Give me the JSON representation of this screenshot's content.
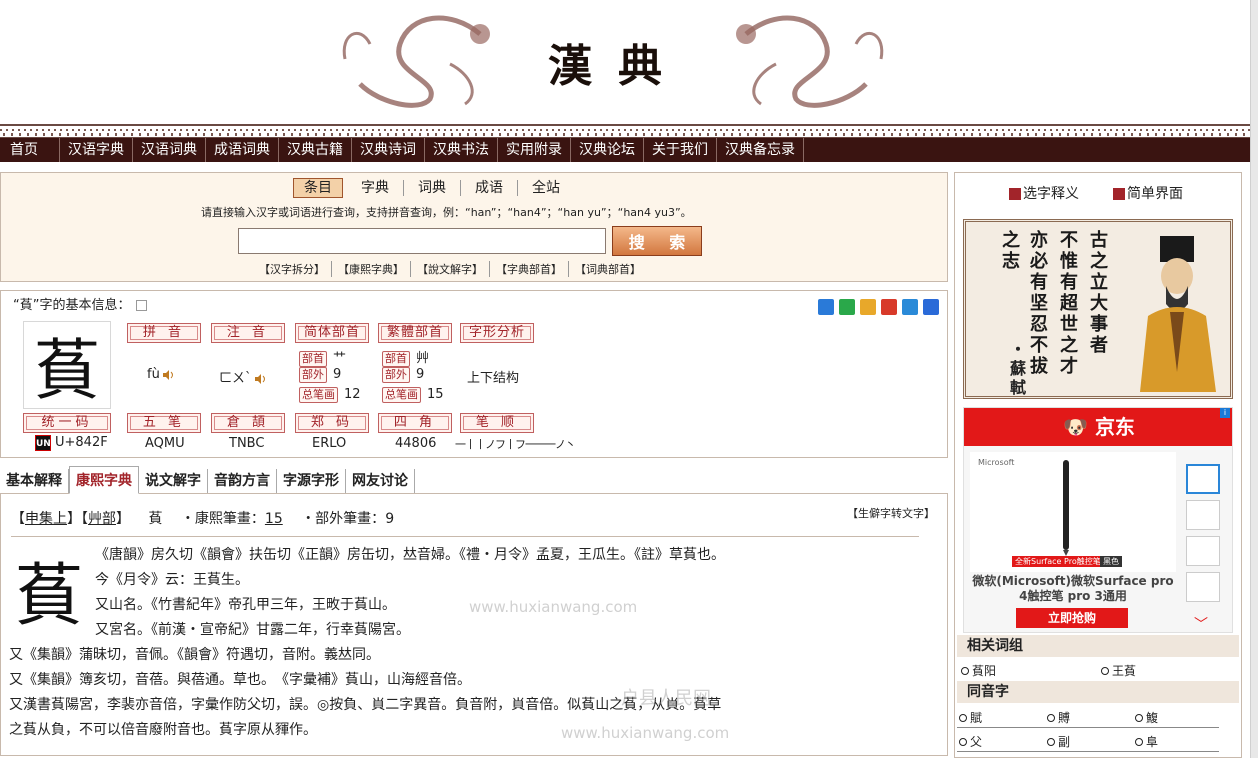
{
  "site": {
    "title": "漢典"
  },
  "nav": [
    "首页",
    "汉语字典",
    "汉语词典",
    "成语词典",
    "汉典古籍",
    "汉典诗词",
    "汉典书法",
    "实用附录",
    "汉典论坛",
    "关于我们",
    "汉典备忘录"
  ],
  "search": {
    "tabs": [
      "条目",
      "字典",
      "词典",
      "成语",
      "全站"
    ],
    "active_tab": "条目",
    "hint": "请直接输入汉字或词语进行查询，支持拼音查询，例：“han”；“han4”；“han yu”；“han4 yu3”。",
    "input_value": "",
    "button_label": "搜 索",
    "links": [
      "【汉字拆分】",
      "【康熙字典】",
      "【說文解字】",
      "【字典部首】",
      "【词典部首】"
    ]
  },
  "basic": {
    "title": "“萯”字的基本信息：",
    "char": "萯",
    "labels": {
      "pinyin": "拼 音",
      "zhuyin": "注 音",
      "simp_radical": "简体部首",
      "trad_radical": "繁體部首",
      "structure": "字形分析",
      "unicode": "统一码",
      "wubi": "五 笔",
      "cangjie": "倉 頡",
      "zhengma": "郑 码",
      "sijiao": "四 角",
      "strokes": "笔 顺"
    },
    "mini_labels": {
      "radical": "部首",
      "outside": "部外",
      "total": "总笔画"
    },
    "pinyin": "fù",
    "zhuyin": "ㄈㄨˋ",
    "simp": {
      "radical": "艹",
      "outside": "9",
      "total": "12"
    },
    "trad": {
      "radical": "艸",
      "outside": "9",
      "total": "15"
    },
    "structure": "上下结构",
    "unicode_logo": "UNI",
    "unicode": "U+842F",
    "wubi": "AQMU",
    "cangjie": "TNBC",
    "zhengma": "ERLO",
    "sijiao": "44806",
    "stroke_order": "一丨丨ノフ丨フ一一一ノ丶"
  },
  "content_tabs": [
    "基本解释",
    "康熙字典",
    "说文解字",
    "音韵方言",
    "字源字形",
    "网友讨论"
  ],
  "active_content_tab": "康熙字典",
  "kangxi": {
    "head_open1": "【",
    "ji": "申集上",
    "head_mid": "】【",
    "bu": "艸部",
    "head_close": "】",
    "char": "萯",
    "strokes_label": "・康熙筆畫：",
    "strokes": "15",
    "outside_label": "・部外筆畫：",
    "outside": "9",
    "convert": "【生僻字转文字】",
    "lines": [
      "《唐韻》房久切《韻會》扶缶切《正韻》房缶切，𠀤音婦。《禮・月令》孟夏，王瓜生。《註》草萯也。",
      "今《月令》云：王萯生。",
      "又山名。《竹書紀年》帝孔甲三年，王畋于萯山。",
      "又宮名。《前漢・宣帝紀》甘露二年，行幸萯陽宮。",
      "又《集韻》蒲昧切，音佩。《韻會》符遇切，音附。義𠀤同。",
      "又《集韻》簿亥切，音蓓。與蓓通。草也。　《字彙補》萯山，山海經音倍。",
      "又漢書萯陽宮，李裴亦音倍，字彙作防父切，誤。◎按負、𧴪二字異音。負音附，𧴪音倍。似萯山之萯，从𧴪。萯草",
      "之萯从負，不可以倍音廢附音也。萯字原从䝍作。"
    ],
    "watermarks": [
      "www.huxianwang.com",
      "户县人民网",
      "www.huxianwang.com"
    ]
  },
  "right": {
    "links": [
      "选字释义",
      "简单界面"
    ],
    "quote_cols": [
      "古之立大事者",
      "不惟有超世之才",
      "亦必有坚忍不拔",
      "之志"
    ],
    "quote_author": "・蘇軾",
    "ad": {
      "brand": "京东",
      "product_brand": "Microsoft",
      "tag1": "全新Surface Pro触控笔",
      "tag2": "黑色",
      "desc": "微软(Microsoft)微软Surface pro 4触控笔 pro 3通用",
      "cta": "立即抢购",
      "more": "﹀"
    },
    "related_title": "相关词组",
    "related": [
      "萯阳",
      "王萯"
    ],
    "homophone_title": "同音字",
    "homophones": [
      "賦",
      "賻",
      "鰒",
      "父",
      "副",
      "阜"
    ]
  },
  "colors": {
    "nav_bg": "#3a1411",
    "accent": "#a2242a",
    "ad_red": "#e21818"
  }
}
